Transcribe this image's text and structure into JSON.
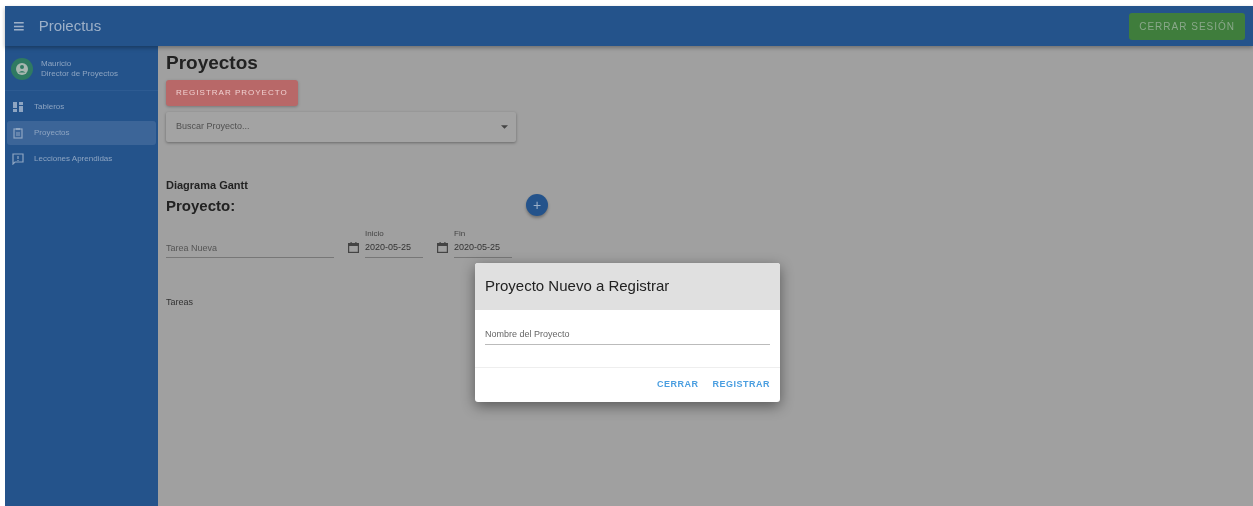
{
  "app_bar": {
    "menu_icon": "≡",
    "title": "Proiectus",
    "logout_button": "CERRAR SESIÓN"
  },
  "sidebar": {
    "user": {
      "name": "Mauricio",
      "role": "Director de Proyectos"
    },
    "items": [
      {
        "label": "Tableros",
        "selected": false
      },
      {
        "label": "Proyectos",
        "selected": true
      },
      {
        "label": "Lecciones Aprendidas",
        "selected": false
      }
    ]
  },
  "page": {
    "title": "Proyectos",
    "register_button": "REGISTRAR PROYECTO",
    "search": {
      "placeholder": "Buscar Proyecto..."
    },
    "gantt_heading": "Diagrama Gantt",
    "project_label": "Proyecto:",
    "task_field": {
      "placeholder": "Tarea Nueva"
    },
    "dates": [
      {
        "label": "Inicio",
        "value": "2020-05-25"
      },
      {
        "label": "Fin",
        "value": "2020-05-25"
      }
    ],
    "add_button": "+",
    "tasks_label": "Tareas"
  },
  "dialog": {
    "title": "Proyecto Nuevo a Registrar",
    "field": {
      "placeholder": "Nombre del Proyecto"
    },
    "buttons": [
      "CERRAR",
      "REGISTRAR"
    ]
  }
}
